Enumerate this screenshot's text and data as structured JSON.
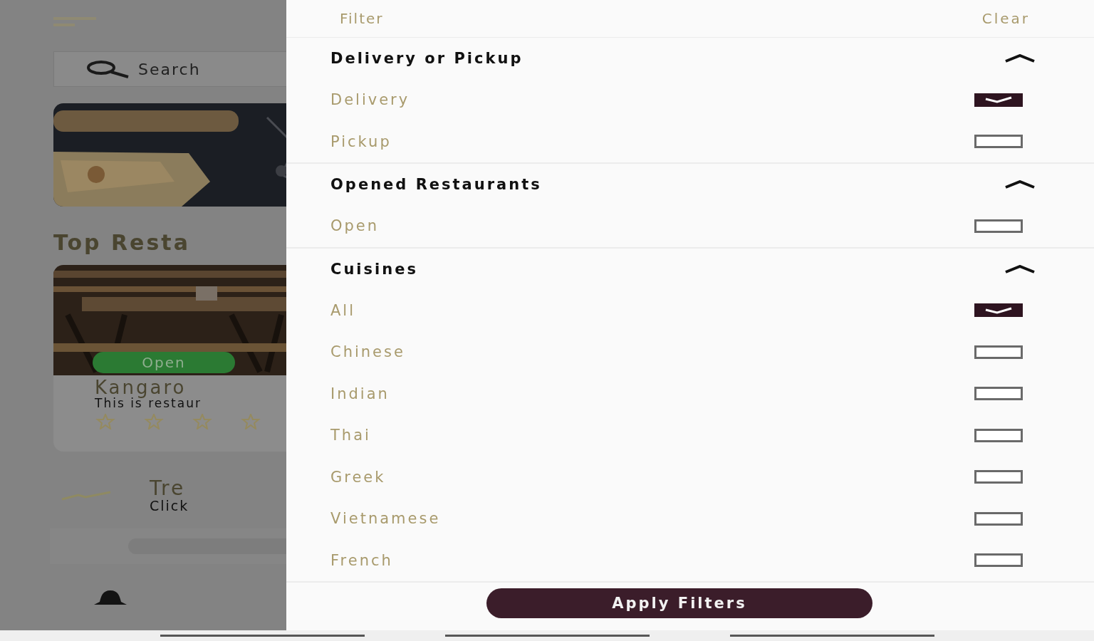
{
  "background": {
    "search": {
      "placeholder": "Search"
    },
    "section_title": "Top Resta",
    "restaurant": {
      "status": "Open",
      "name": "Kangaro",
      "description": "This is restaur"
    },
    "trending": {
      "title": "Tre",
      "subtitle": "Click"
    }
  },
  "filter": {
    "title": "Filter",
    "clear": "Clear",
    "sections": [
      {
        "title": "Delivery or Pickup",
        "expanded": true,
        "options": [
          {
            "label": "Delivery",
            "checked": true
          },
          {
            "label": "Pickup",
            "checked": false
          }
        ]
      },
      {
        "title": "Opened Restaurants",
        "expanded": true,
        "options": [
          {
            "label": "Open",
            "checked": false
          }
        ]
      },
      {
        "title": "Cuisines",
        "expanded": true,
        "options": [
          {
            "label": "All",
            "checked": true
          },
          {
            "label": "Chinese",
            "checked": false
          },
          {
            "label": "Indian",
            "checked": false
          },
          {
            "label": "Thai",
            "checked": false
          },
          {
            "label": "Greek",
            "checked": false
          },
          {
            "label": "Vietnamese",
            "checked": false
          },
          {
            "label": "French",
            "checked": false
          }
        ]
      }
    ],
    "apply": "Apply Filters"
  }
}
